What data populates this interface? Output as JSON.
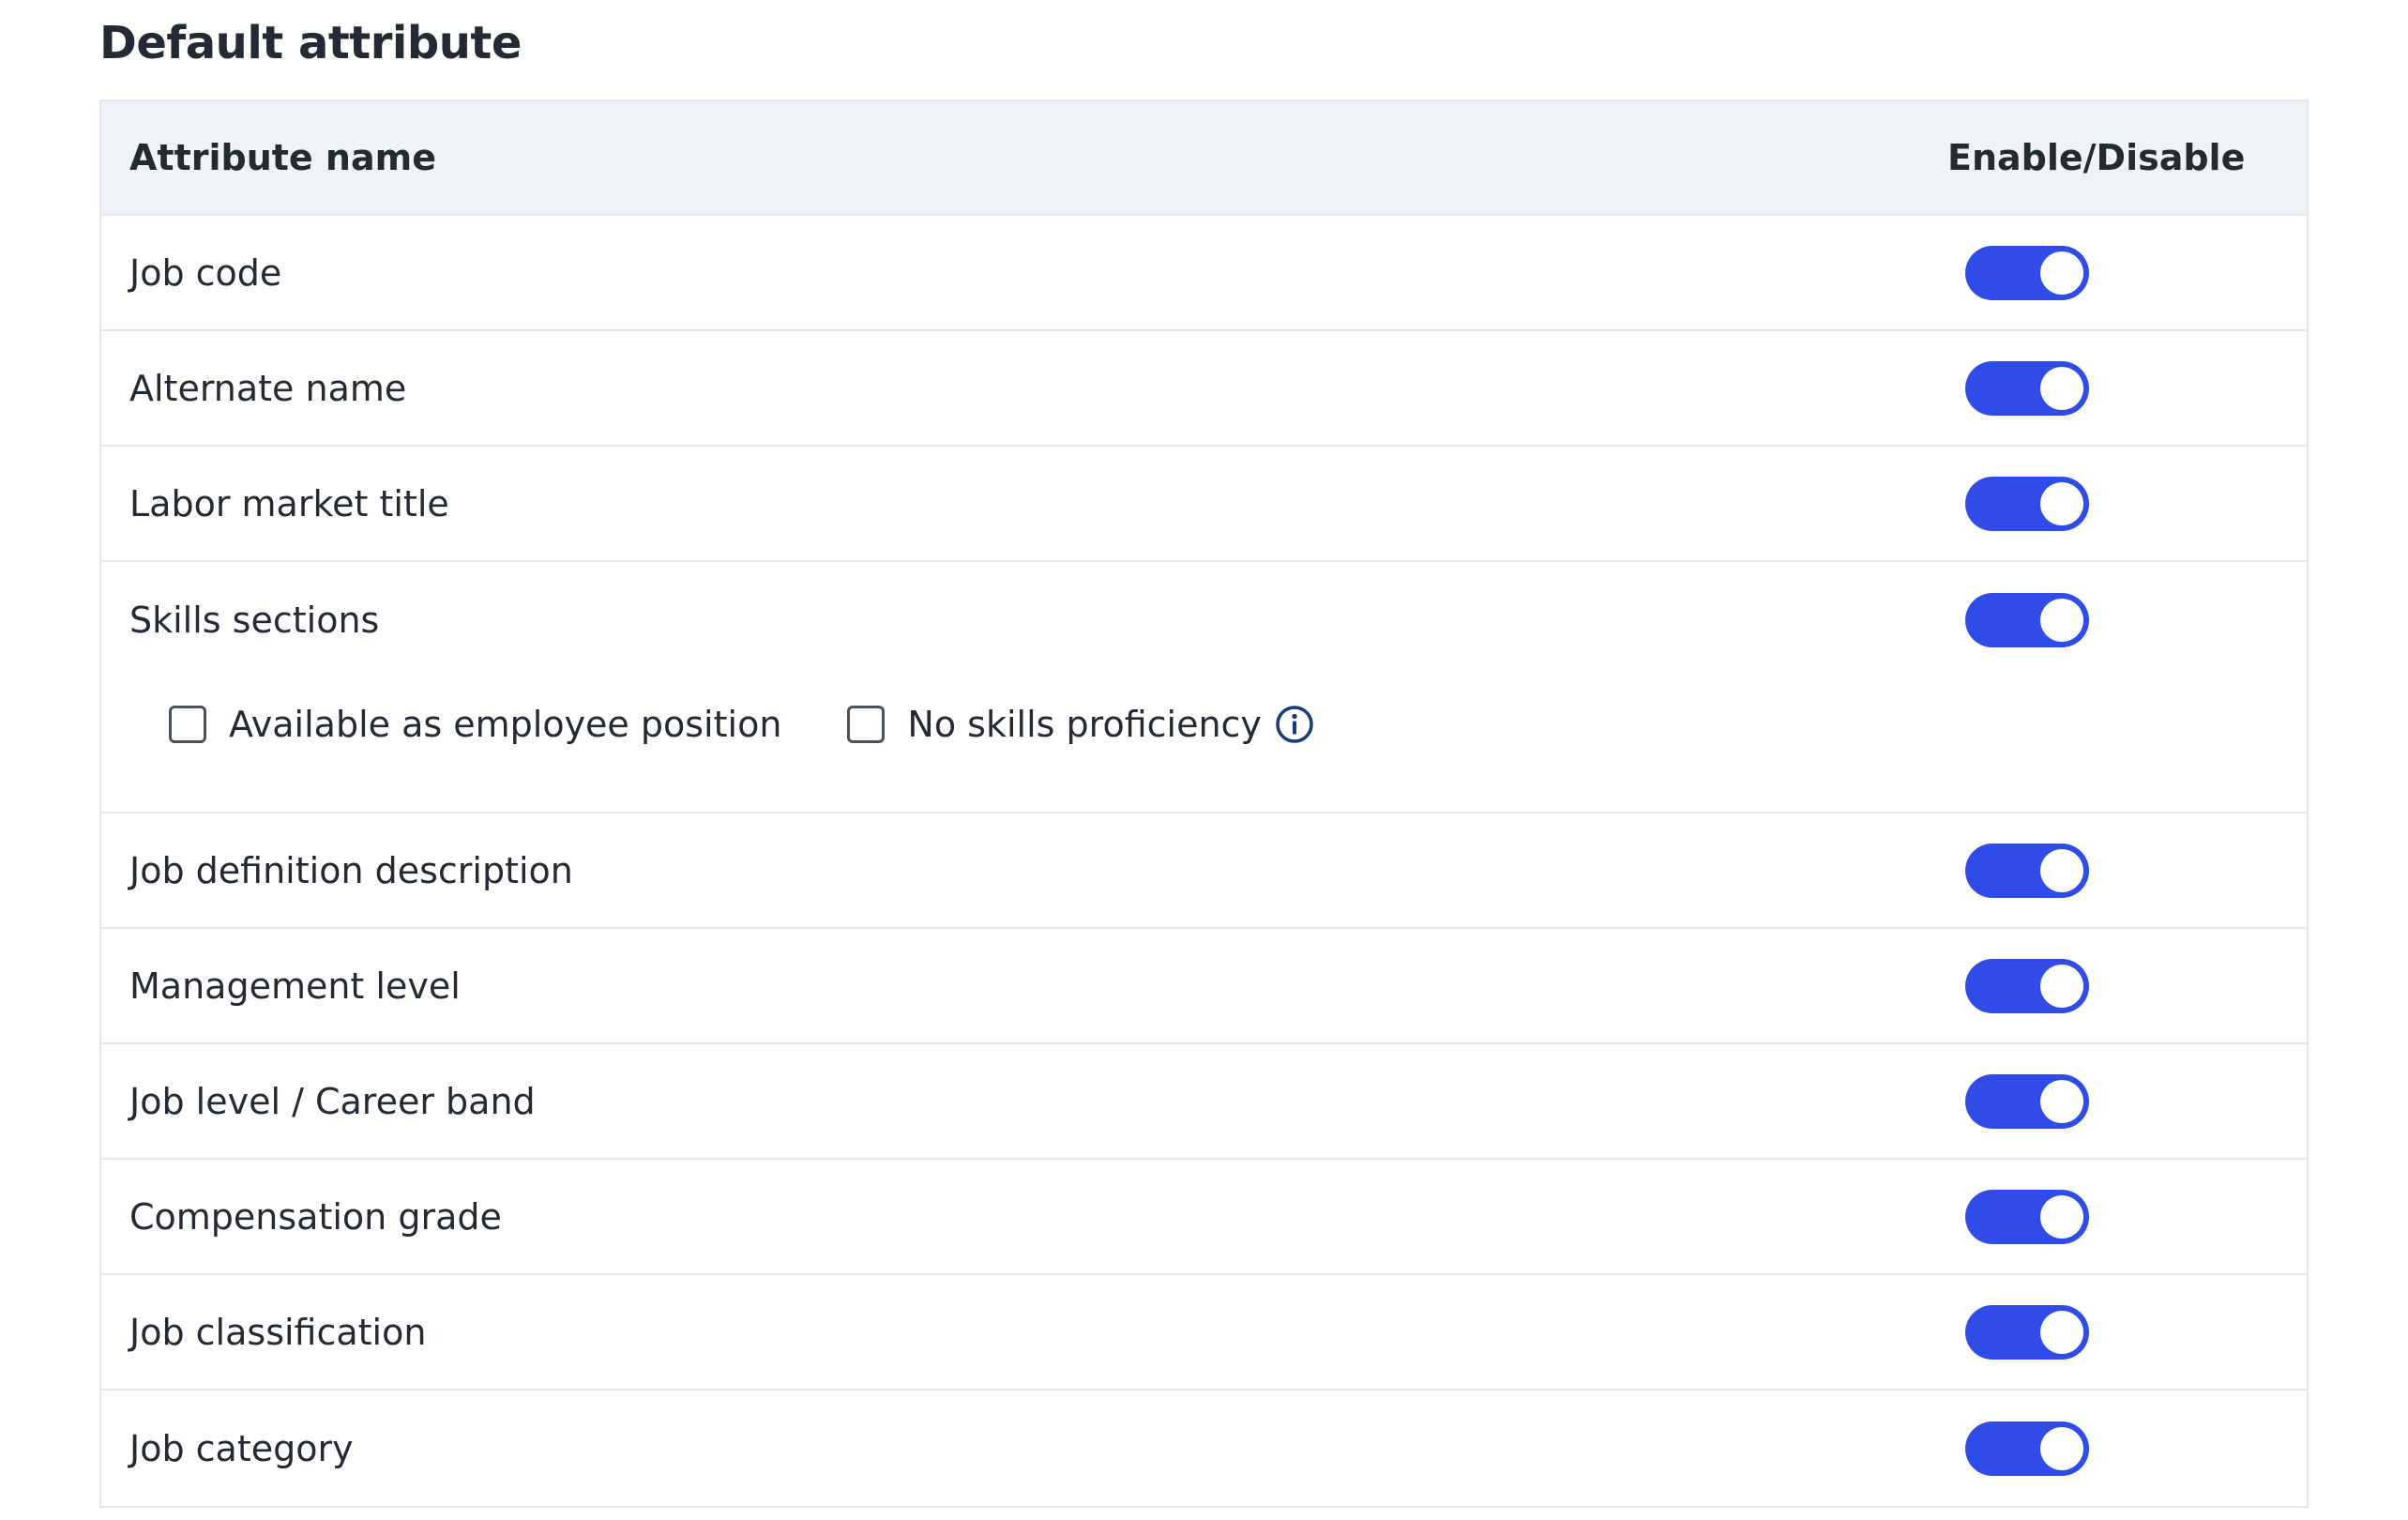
{
  "page": {
    "title": "Default attribute"
  },
  "table": {
    "headers": {
      "name": "Attribute name",
      "toggle": "Enable/Disable"
    },
    "rows": [
      {
        "label": "Job code",
        "enabled": true
      },
      {
        "label": "Alternate name",
        "enabled": true
      },
      {
        "label": "Labor market title",
        "enabled": true
      },
      {
        "label": "Skills sections",
        "enabled": true
      },
      {
        "label": "Job definition description",
        "enabled": true
      },
      {
        "label": "Management level",
        "enabled": true
      },
      {
        "label": "Job level / Career band",
        "enabled": true
      },
      {
        "label": "Compensation grade",
        "enabled": true
      },
      {
        "label": "Job classification",
        "enabled": true
      },
      {
        "label": "Job category",
        "enabled": true
      }
    ],
    "skills_options": [
      {
        "label": "Available as employee position",
        "checked": false
      },
      {
        "label": "No skills proficiency",
        "checked": false,
        "icon": "info-icon"
      }
    ]
  },
  "colors": {
    "toggle_on": "#2f4be8",
    "header_bg": "#f0f2fa",
    "border": "#e4e7ec",
    "info_icon": "#1b3a7a"
  }
}
